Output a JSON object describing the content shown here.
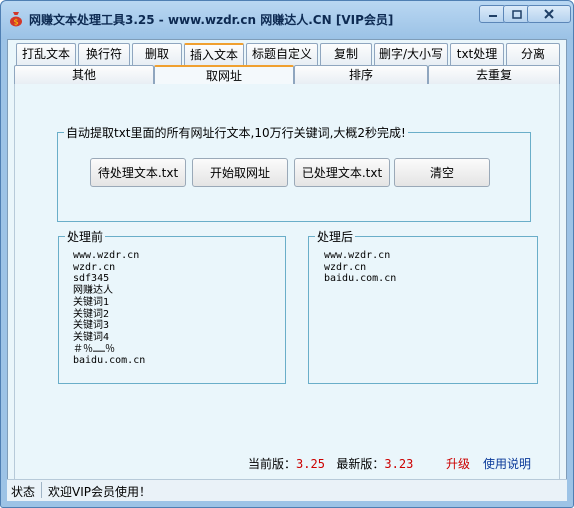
{
  "window": {
    "title": "网赚文本处理工具3.25 - www.wzdr.cn 网赚达人.CN [VIP会员]"
  },
  "tabs_row1": [
    "打乱文本",
    "换行符",
    "删取",
    "插入文本",
    "标题自定义",
    "复制",
    "删字/大小写",
    "txt处理",
    "分离"
  ],
  "tabs_row2": [
    "其他",
    "取网址",
    "排序",
    "去重复"
  ],
  "selected_tab": "取网址",
  "action_group": {
    "legend": "自动提取txt里面的所有网址行文本,10万行关键词,大概2秒完成!",
    "buttons": [
      "待处理文本.txt",
      "开始取网址",
      "已处理文本.txt",
      "清空"
    ]
  },
  "before": {
    "legend": "处理前",
    "lines": [
      "www.wzdr.cn",
      "wzdr.cn",
      "sdf345",
      "网赚达人",
      "关键词1",
      "关键词2",
      "关键词3",
      "关键词4",
      "＃％……％",
      "baidu.com.cn"
    ]
  },
  "after": {
    "legend": "处理后",
    "lines": [
      "www.wzdr.cn",
      "wzdr.cn",
      "baidu.com.cn"
    ]
  },
  "version": {
    "current_label": "当前版：",
    "current_value": "3.25",
    "latest_label": "最新版：",
    "latest_value": "3.23",
    "upgrade_link": "升级",
    "help_link": "使用说明"
  },
  "status": {
    "label": "状态",
    "message": "欢迎VIP会员使用！"
  },
  "colors": {
    "tab_accent": "#f0a030",
    "group_border": "#6aaec9",
    "version_value": "#cc0000",
    "help_link": "#0a3a9a"
  }
}
